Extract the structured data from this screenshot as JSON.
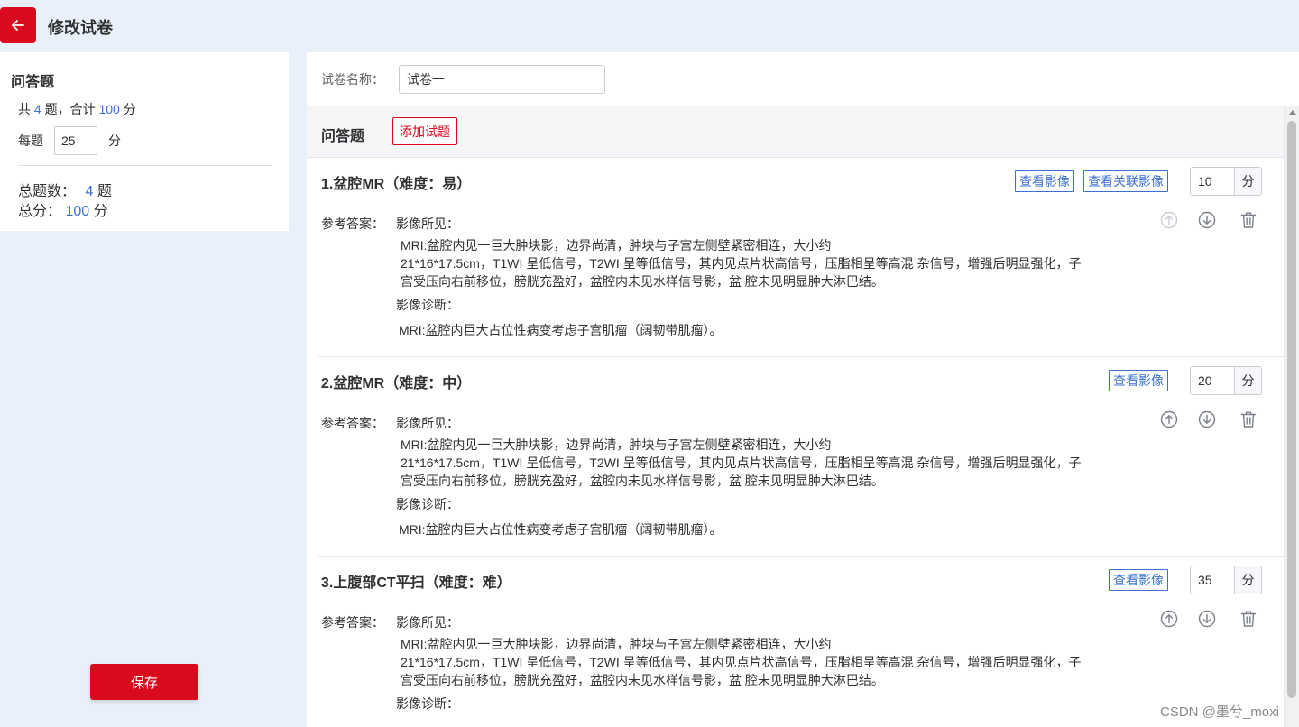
{
  "header": {
    "back_icon": "arrow-left-icon",
    "title": "修改试卷"
  },
  "sidebar": {
    "title": "问答题",
    "summary": {
      "prefix": "共",
      "count": "4",
      "mid": "题，合计",
      "score": "100",
      "suffix": "分"
    },
    "each": {
      "label": "每题",
      "value": "25",
      "unit": "分"
    },
    "total_count": {
      "label": "总题数：",
      "value": "4",
      "unit": "题"
    },
    "total_score": {
      "label": "总分：",
      "value": "100",
      "unit": "分"
    },
    "save_label": "保存"
  },
  "form": {
    "name_label": "试卷名称：",
    "name_value": "试卷一"
  },
  "section": {
    "title": "问答题",
    "add_label": "添加试题"
  },
  "questions": [
    {
      "title": "1.盆腔MR（难度：易）",
      "buttons": [
        "查看影像",
        "查看关联影像"
      ],
      "score": "10",
      "unit": "分",
      "answer_label": "参考答案：",
      "findings_head": "影像所见：",
      "findings": [
        "MRI:盆腔内见一巨大肿块影，边界尚清，肿块与子宫左侧壁紧密相连，大小约",
        "21*16*17.5cm，T1WI 呈低信号，T2WI 呈等低信号，其内见点片状高信号，压脂相呈等高混 杂信号，增强后明显强化，子",
        "宫受压向右前移位，膀胱充盈好，盆腔内未见水样信号影，盆 腔未见明显肿大淋巴结。"
      ],
      "diagnosis_head": "影像诊断：",
      "diagnosis": "MRI:盆腔内巨大占位性病变考虑子宫肌瘤（阔韧带肌瘤）。",
      "up_enabled": false
    },
    {
      "title": "2.盆腔MR（难度：中）",
      "buttons": [
        "查看影像"
      ],
      "score": "20",
      "unit": "分",
      "answer_label": "参考答案：",
      "findings_head": "影像所见：",
      "findings": [
        "MRI:盆腔内见一巨大肿块影，边界尚清，肿块与子宫左侧壁紧密相连，大小约",
        "21*16*17.5cm，T1WI 呈低信号，T2WI 呈等低信号，其内见点片状高信号，压脂相呈等高混 杂信号，增强后明显强化，子",
        "宫受压向右前移位，膀胱充盈好，盆腔内未见水样信号影，盆 腔未见明显肿大淋巴结。"
      ],
      "diagnosis_head": "影像诊断：",
      "diagnosis": "MRI:盆腔内巨大占位性病变考虑子宫肌瘤（阔韧带肌瘤）。",
      "up_enabled": true
    },
    {
      "title": "3.上腹部CT平扫（难度：难）",
      "buttons": [
        "查看影像"
      ],
      "score": "35",
      "unit": "分",
      "answer_label": "参考答案：",
      "findings_head": "影像所见：",
      "findings": [
        "MRI:盆腔内见一巨大肿块影，边界尚清，肿块与子宫左侧壁紧密相连，大小约",
        "21*16*17.5cm，T1WI 呈低信号，T2WI 呈等低信号，其内见点片状高信号，压脂相呈等高混 杂信号，增强后明显强化，子",
        "宫受压向右前移位，膀胱充盈好，盆腔内未见水样信号影，盆 腔未见明显肿大淋巴结。"
      ],
      "diagnosis_head": "影像诊断：",
      "diagnosis": "",
      "up_enabled": true
    }
  ],
  "icons": {
    "up": "arrow-up-circle-icon",
    "down": "arrow-down-circle-icon",
    "delete": "trash-icon"
  },
  "watermark": "CSDN @墨兮_moxi"
}
